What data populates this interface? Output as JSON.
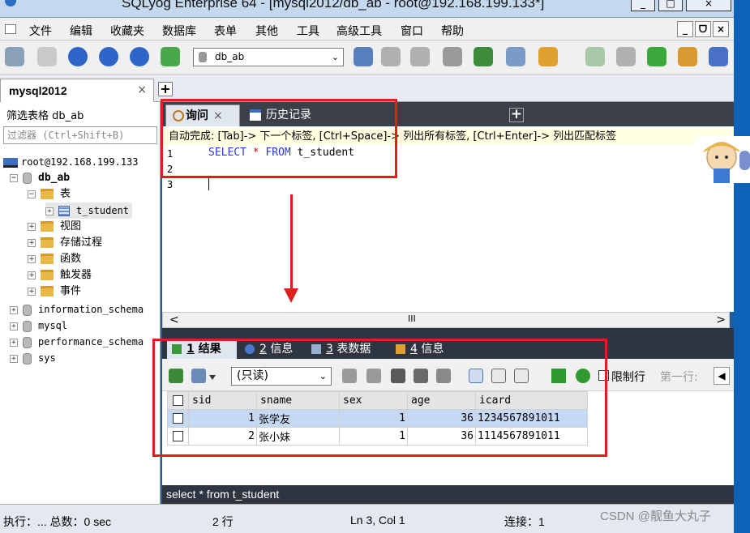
{
  "window": {
    "title": "SQLyog Enterprise 64 - [mysql2012/db_ab - root@192.168.199.133*]",
    "controls": [
      "_",
      "□",
      "×"
    ]
  },
  "menu": {
    "items": [
      "文件",
      "编辑",
      "收藏夹",
      "数据库",
      "表单",
      "其他",
      "工具",
      "高级工具",
      "窗口",
      "帮助"
    ],
    "mdi_controls": [
      "_",
      "ᗜ",
      "×"
    ]
  },
  "toolbar": {
    "db_select_value": "db_ab",
    "db_select_arrow": "⌄"
  },
  "connection_tab": {
    "label": "mysql2012",
    "close": "×",
    "plus": "+"
  },
  "object_browser": {
    "filter_label": "筛选表格 db_ab",
    "filter_placeholder": "过滤器 (Ctrl+Shift+B)",
    "server": "root@192.168.199.133",
    "current_db": "db_ab",
    "tables_folder": "表",
    "table": "t_student",
    "folders": [
      "视图",
      "存储过程",
      "函数",
      "触发器",
      "事件"
    ],
    "databases": [
      "information_schema",
      "mysql",
      "performance_schema",
      "sys"
    ],
    "expand_minus": "−",
    "expand_plus": "+"
  },
  "query_tabs": {
    "active_label": "询问",
    "active_close": "×",
    "history_label": "历史记录",
    "plus": "+"
  },
  "editor": {
    "autocomplete_hint": "自动完成: [Tab]-> 下一个标签, [Ctrl+Space]-> 列出所有标签, [Ctrl+Enter]-> 列出匹配标签",
    "line_numbers": [
      "1",
      "2",
      "3"
    ],
    "code": {
      "select": "SELECT",
      "star": "*",
      "from": "FROM",
      "table": "t_student"
    },
    "scroll_left": "<",
    "scroll_right": ">",
    "scroll_thumb": "III"
  },
  "result_tabs": [
    {
      "num": "1",
      "label": "结果"
    },
    {
      "num": "2",
      "label": "信息"
    },
    {
      "num": "3",
      "label": "表数据"
    },
    {
      "num": "4",
      "label": "信息"
    }
  ],
  "result_toolbar": {
    "mode_select": "(只读)",
    "mode_arrow": "⌄",
    "limit_label": "限制行",
    "first_row_label": "第一行:",
    "nav_left": "◀"
  },
  "result_grid": {
    "columns": [
      "sid",
      "sname",
      "sex",
      "age",
      "icard"
    ],
    "rows": [
      [
        "1",
        "张学友",
        "1",
        "36",
        "1234567891011"
      ],
      [
        "2",
        "张小妹",
        "1",
        "36",
        "1114567891011"
      ]
    ]
  },
  "sql_preview": "select * from t_student",
  "status": {
    "exec": "执行：... 总数：0 sec",
    "rows": "2 行",
    "position": "Ln 3, Col 1",
    "connections": "连接：1"
  },
  "watermark": "CSDN @靓鱼大丸子",
  "colors": {
    "annotation_red": "#e01e1e",
    "keyword_blue": "#2b36d4",
    "selection_row": "#c5d9f5"
  }
}
